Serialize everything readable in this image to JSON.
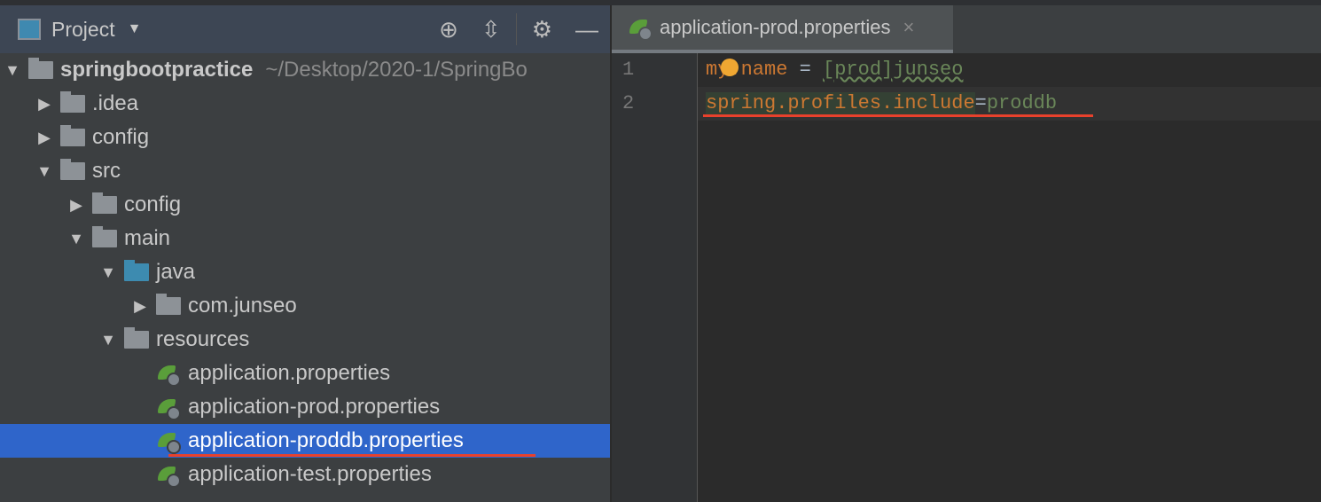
{
  "project_panel": {
    "title": "Project",
    "icons": [
      "crosshair-icon",
      "collapse-icon",
      "gear-icon",
      "minimize-icon"
    ],
    "tree": [
      {
        "label": "springbootpractice",
        "path": "~/Desktop/2020-1/SpringBo",
        "level": 0,
        "expanded": true,
        "type": "module"
      },
      {
        "label": ".idea",
        "level": 1,
        "expanded": false,
        "type": "folder"
      },
      {
        "label": "config",
        "level": 1,
        "expanded": false,
        "type": "folder"
      },
      {
        "label": "src",
        "level": 1,
        "expanded": true,
        "type": "folder"
      },
      {
        "label": "config",
        "level": 2,
        "expanded": false,
        "type": "folder"
      },
      {
        "label": "main",
        "level": 2,
        "expanded": true,
        "type": "folder"
      },
      {
        "label": "java",
        "level": 3,
        "expanded": true,
        "type": "source-folder"
      },
      {
        "label": "com.junseo",
        "level": 4,
        "expanded": false,
        "type": "package"
      },
      {
        "label": "resources",
        "level": 3,
        "expanded": true,
        "type": "resources-folder"
      },
      {
        "label": "application.properties",
        "level": 4,
        "type": "file"
      },
      {
        "label": "application-prod.properties",
        "level": 4,
        "type": "file"
      },
      {
        "label": "application-proddb.properties",
        "level": 4,
        "type": "file",
        "selected": true
      },
      {
        "label": "application-test.properties",
        "level": 4,
        "type": "file"
      }
    ]
  },
  "editor": {
    "tab": {
      "label": "application-prod.properties",
      "close": "×"
    },
    "lines": [
      {
        "number": "1",
        "key": "my.name",
        "eq": " = ",
        "value": "[prod]junseo"
      },
      {
        "number": "2",
        "key": "spring.profiles.include",
        "eq": "=",
        "value": "proddb"
      }
    ]
  }
}
